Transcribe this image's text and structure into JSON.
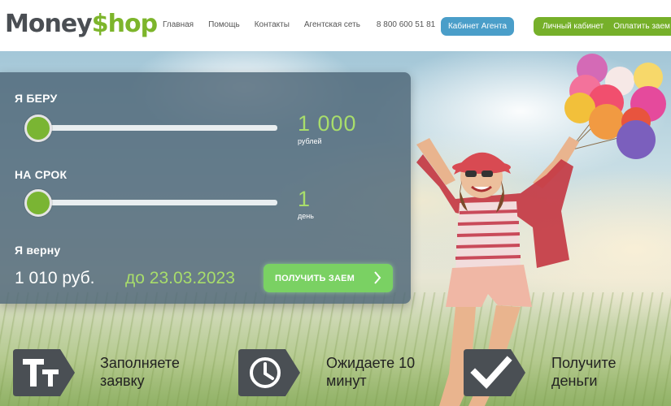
{
  "header": {
    "logo_money": "Money",
    "logo_dollar": "$",
    "logo_shop": "hop",
    "nav": [
      {
        "label": "Главная"
      },
      {
        "label": "Помощь"
      },
      {
        "label": "Контакты"
      },
      {
        "label": "Агентская сеть"
      },
      {
        "label": "8 800 600 51 81"
      }
    ],
    "agent_button": "Кабинет Агента",
    "cabinet_button": "Личный кабинет",
    "pay_button": "Оплатить заем"
  },
  "calculator": {
    "amount_label": "Я БЕРУ",
    "amount_value": "1 000",
    "amount_unit": "рублей",
    "amount_slider_fraction": 0,
    "term_label": "НА СРОК",
    "term_value": "1",
    "term_unit": "день",
    "term_slider_fraction": 0,
    "return_label": "Я верну",
    "return_sum": "1 010 руб.",
    "return_date": "до 23.03.2023",
    "submit_button": "ПОЛУЧИТЬ ЗАЕМ"
  },
  "steps": [
    {
      "line1": "Заполняете",
      "line2": "заявку",
      "icon": "text-icon"
    },
    {
      "line1": "Ожидаете 10",
      "line2": "минут",
      "icon": "clock-icon"
    },
    {
      "line1": "Получите",
      "line2": "деньги",
      "icon": "checkmark-icon"
    }
  ],
  "colors": {
    "brand_green": "#7db52b",
    "agent_blue": "#4a9ec9",
    "panel_bg": "#4d6576",
    "highlight_green": "#a8dd6b",
    "loan_button": "#7ad163",
    "icon_dark": "#4a4f54"
  }
}
